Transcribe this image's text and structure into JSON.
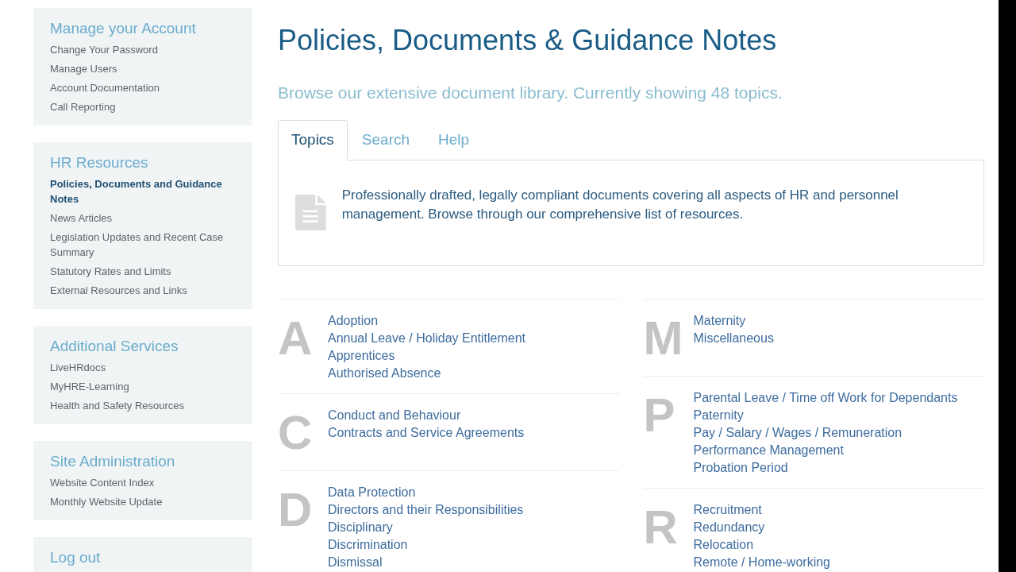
{
  "sidebar": {
    "sections": [
      {
        "title": "Manage your Account",
        "items": [
          {
            "label": "Change Your Password",
            "selected": false
          },
          {
            "label": "Manage Users",
            "selected": false
          },
          {
            "label": "Account Documentation",
            "selected": false
          },
          {
            "label": "Call Reporting",
            "selected": false
          }
        ]
      },
      {
        "title": "HR Resources",
        "items": [
          {
            "label": "Policies, Documents and Guidance Notes",
            "selected": true
          },
          {
            "label": "News Articles",
            "selected": false
          },
          {
            "label": "Legislation Updates and Recent Case Summary",
            "selected": false
          },
          {
            "label": "Statutory Rates and Limits",
            "selected": false
          },
          {
            "label": "External Resources and Links",
            "selected": false
          }
        ]
      },
      {
        "title": "Additional Services",
        "items": [
          {
            "label": "LiveHRdocs",
            "selected": false
          },
          {
            "label": "MyHRE-Learning",
            "selected": false
          },
          {
            "label": "Health and Safety Resources",
            "selected": false
          }
        ]
      },
      {
        "title": "Site Administration",
        "items": [
          {
            "label": "Website Content Index",
            "selected": false
          },
          {
            "label": "Monthly Website Update",
            "selected": false
          }
        ]
      },
      {
        "title": "Log out"
      }
    ]
  },
  "page": {
    "title": "Policies, Documents & Guidance Notes",
    "subtitle": "Browse our extensive document library. Currently showing 48 topics."
  },
  "tabs": [
    {
      "label": "Topics",
      "selected": true
    },
    {
      "label": "Search",
      "selected": false
    },
    {
      "label": "Help",
      "selected": false
    }
  ],
  "intro": "Professionally drafted, legally compliant documents covering all aspects of HR and personnel management. Browse through our comprehensive list of resources.",
  "topic_columns": [
    [
      {
        "letter": "A",
        "topics": [
          "Adoption",
          "Annual Leave / Holiday Entitlement",
          "Apprentices",
          "Authorised Absence"
        ]
      },
      {
        "letter": "C",
        "topics": [
          "Conduct and Behaviour",
          "Contracts and Service Agreements"
        ]
      },
      {
        "letter": "D",
        "topics": [
          "Data Protection",
          "Directors and their Responsibilities",
          "Disciplinary",
          "Discrimination",
          "Dismissal"
        ]
      }
    ],
    [
      {
        "letter": "M",
        "topics": [
          "Maternity",
          "Miscellaneous"
        ]
      },
      {
        "letter": "P",
        "topics": [
          "Parental Leave / Time off Work for Dependants",
          "Paternity",
          "Pay / Salary / Wages / Remuneration",
          "Performance Management",
          "Probation Period"
        ]
      },
      {
        "letter": "R",
        "topics": [
          "Recruitment",
          "Redundancy",
          "Relocation",
          "Remote / Home-working"
        ]
      }
    ]
  ]
}
